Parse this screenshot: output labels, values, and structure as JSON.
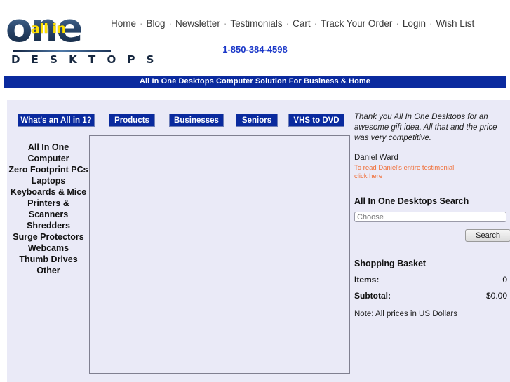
{
  "header": {
    "logo": {
      "word": "one",
      "overlay": "all in",
      "subtitle": "D E S K T O P S"
    },
    "nav": [
      "Home",
      "Blog",
      "Newsletter",
      "Testimonials",
      "Cart",
      "Track Your Order",
      "Login",
      "Wish List"
    ],
    "nav_separator": "·",
    "phone": "1-850-384-4598"
  },
  "banner": {
    "text": "All In One Desktops Computer Solution For Business & Home"
  },
  "tabs": [
    "What's an All in 1?",
    "Products",
    "Businesses",
    "Seniors",
    "VHS to DVD"
  ],
  "sidebar": {
    "categories": [
      "All In One Computer",
      "Zero Footprint PCs",
      "Laptops",
      "Keyboards & Mice",
      "Printers & Scanners",
      "Shredders",
      "Surge Protectors",
      "Webcams",
      "Thumb Drives",
      "Other"
    ]
  },
  "right": {
    "testimonial": {
      "quote": "Thank you All In One Desktops for an awesome gift idea.  All that and the price was very competitive.",
      "author": "Daniel Ward",
      "link_line1": "To read Daniel's entire testimonial",
      "link_line2": "click here"
    },
    "search": {
      "title": "All In One Desktops Search",
      "placeholder": "Choose",
      "value": "",
      "button_label": "Search"
    },
    "basket": {
      "title": "Shopping Basket",
      "items_label": "Items:",
      "items_value": "0",
      "subtotal_label": "Subtotal:",
      "subtotal_value": "$0.00",
      "note": "Note: All prices in US Dollars"
    }
  },
  "colors": {
    "banner_blue": "#0a2a9e",
    "panel_lavender": "#eaeaf7",
    "link_orange": "#f0703a",
    "phone_blue": "#1a37c8",
    "logo_yellow": "#ffe000"
  }
}
